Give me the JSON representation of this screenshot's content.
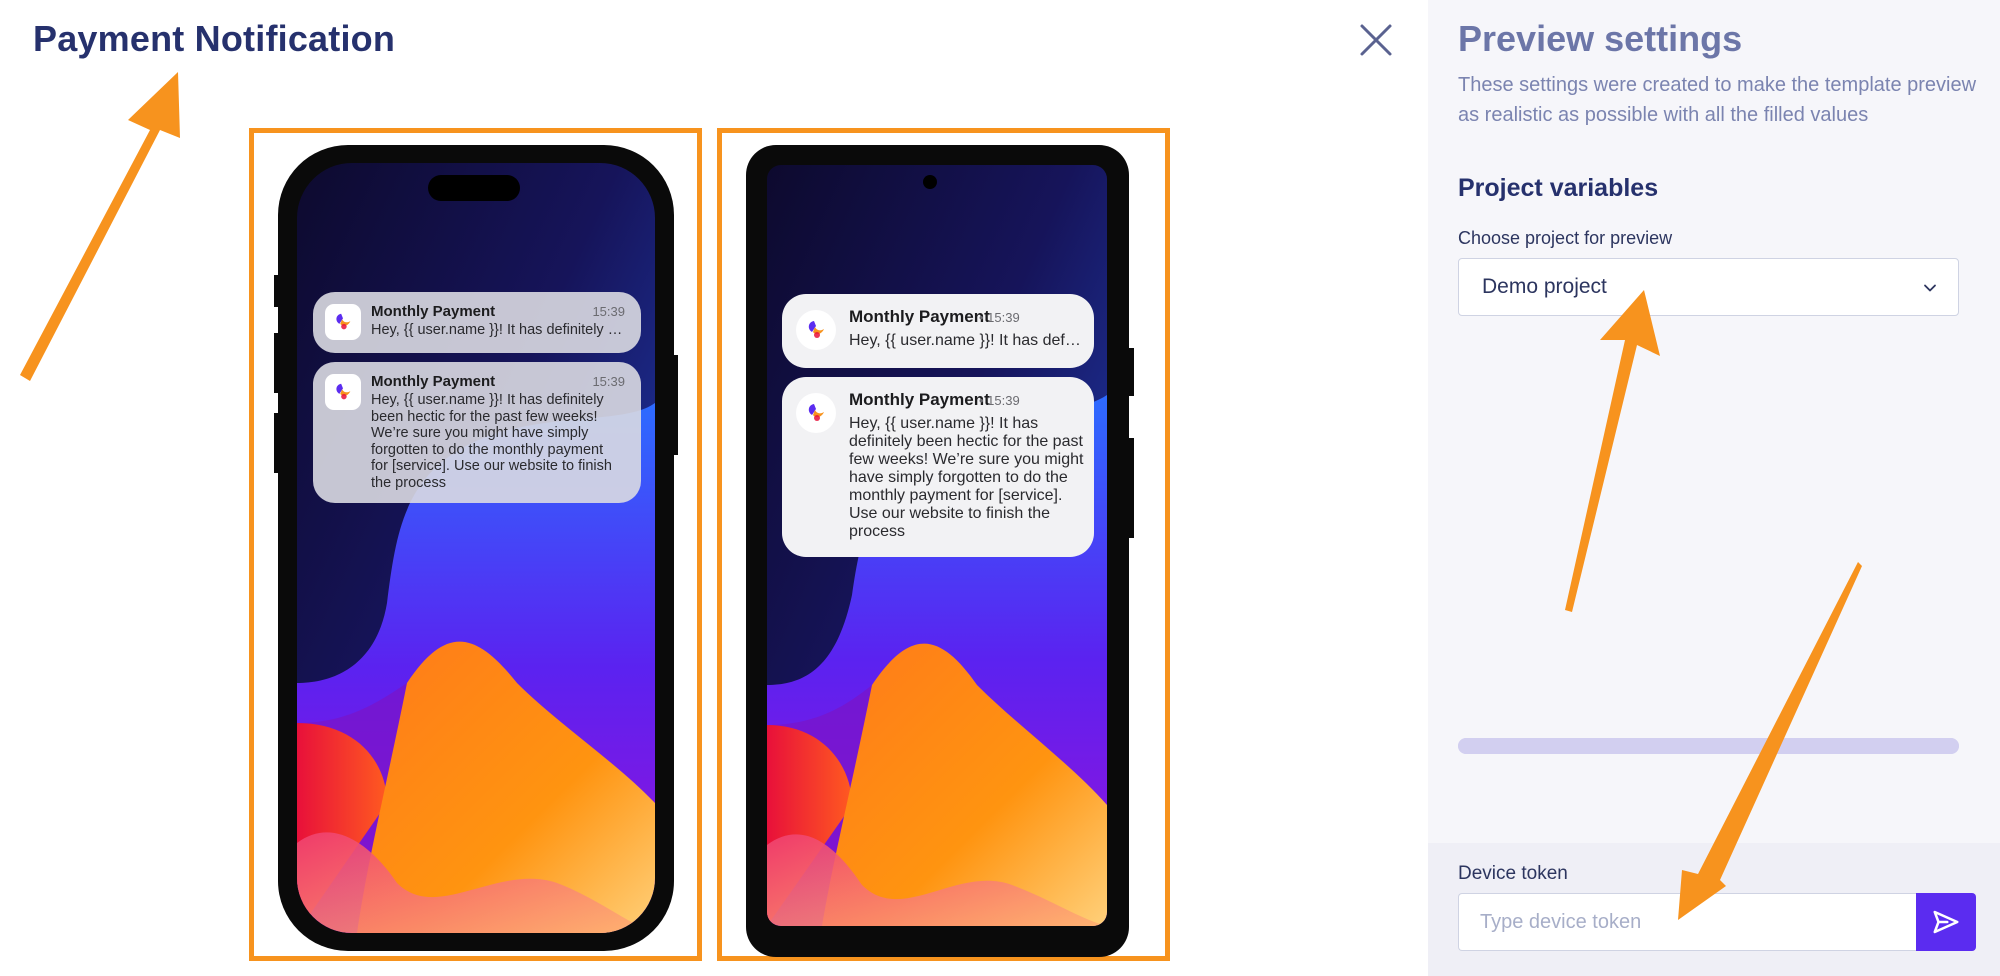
{
  "header": {
    "title": "Payment Notification"
  },
  "settings": {
    "title": "Preview settings",
    "description": "These settings were created to make the template preview as realistic as possible with all the filled values",
    "project_section_title": "Project variables",
    "project_label": "Choose project for preview",
    "project_value": "Demo project",
    "loading_progress": 1.0,
    "device_token_label": "Device token",
    "device_token_placeholder": "Type device token",
    "device_token_value": ""
  },
  "previews": {
    "ios": {
      "collapsed": {
        "title": "Monthly Payment",
        "time": "15:39",
        "body": "Hey, {{ user.name }}! It has definitely been hectic for the past few weeks!"
      },
      "expanded": {
        "title": "Monthly Payment",
        "time": "15:39",
        "body": "Hey, {{ user.name }}! It has definitely been hectic for the past few weeks! We’re sure you might have simply forgotten to do the monthly payment for [service]. Use our website to finish the process"
      }
    },
    "android": {
      "collapsed": {
        "title": "Monthly Payment",
        "time": "• 15:39",
        "body": "Hey, {{ user.name }}! It has definitely been hectic for the past few weeks!"
      },
      "expanded": {
        "title": "Monthly Payment",
        "time": "• 15:39",
        "body": "Hey, {{ user.name }}! It has definitely been hectic for the past few weeks! We’re sure you might have simply forgotten to do the monthly payment for [service]. Use our website to finish the process"
      }
    }
  },
  "colors": {
    "accent_orange": "#f7931e",
    "brand_purple": "#5b2cf0",
    "heading_navy": "#26316d"
  },
  "icons": {
    "close": "close-icon",
    "chevron": "chevron-down-icon",
    "send": "send-icon",
    "app": "app-logo-icon"
  }
}
